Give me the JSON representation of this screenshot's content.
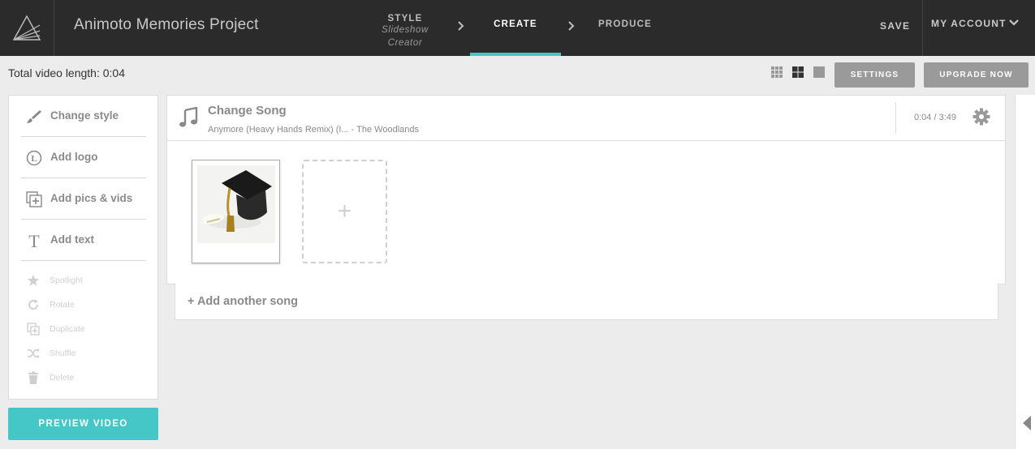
{
  "app": {
    "project_title": "Animoto Memories Project"
  },
  "steps": {
    "style": {
      "label": "STYLE",
      "sub1": "Slideshow",
      "sub2": "Creator"
    },
    "create": {
      "label": "CREATE"
    },
    "produce": {
      "label": "PRODUCE"
    }
  },
  "header": {
    "save_label": "SAVE",
    "account_label": "MY ACCOUNT"
  },
  "toolbar": {
    "video_length": "Total video length: 0:04",
    "settings_label": "SETTINGS",
    "upgrade_label": "UPGRADE NOW"
  },
  "sidebar": {
    "tools": [
      {
        "label": "Change style",
        "icon": "brush-icon"
      },
      {
        "label": "Add logo",
        "icon": "logo-icon"
      },
      {
        "label": "Add pics & vids",
        "icon": "add-media-icon"
      },
      {
        "label": "Add text",
        "icon": "text-icon"
      }
    ],
    "minor_tools": [
      {
        "label": "Spotlight",
        "icon": "star-icon"
      },
      {
        "label": "Rotate",
        "icon": "rotate-icon"
      },
      {
        "label": "Duplicate",
        "icon": "duplicate-icon"
      },
      {
        "label": "Shuffle",
        "icon": "shuffle-icon"
      },
      {
        "label": "Delete",
        "icon": "trash-icon"
      }
    ],
    "preview_label": "PREVIEW VIDEO"
  },
  "song": {
    "title": "Change Song",
    "subtitle": "Anymore (Heavy Hands Remix) (I... - The Woodlands",
    "time": "0:04 / 3:49",
    "add_slot_label": "+",
    "add_another": "+ Add another song"
  },
  "colors": {
    "accent": "#45c7c8",
    "topbar": "#2b2b2b",
    "button_gray": "#9a9a9a"
  }
}
